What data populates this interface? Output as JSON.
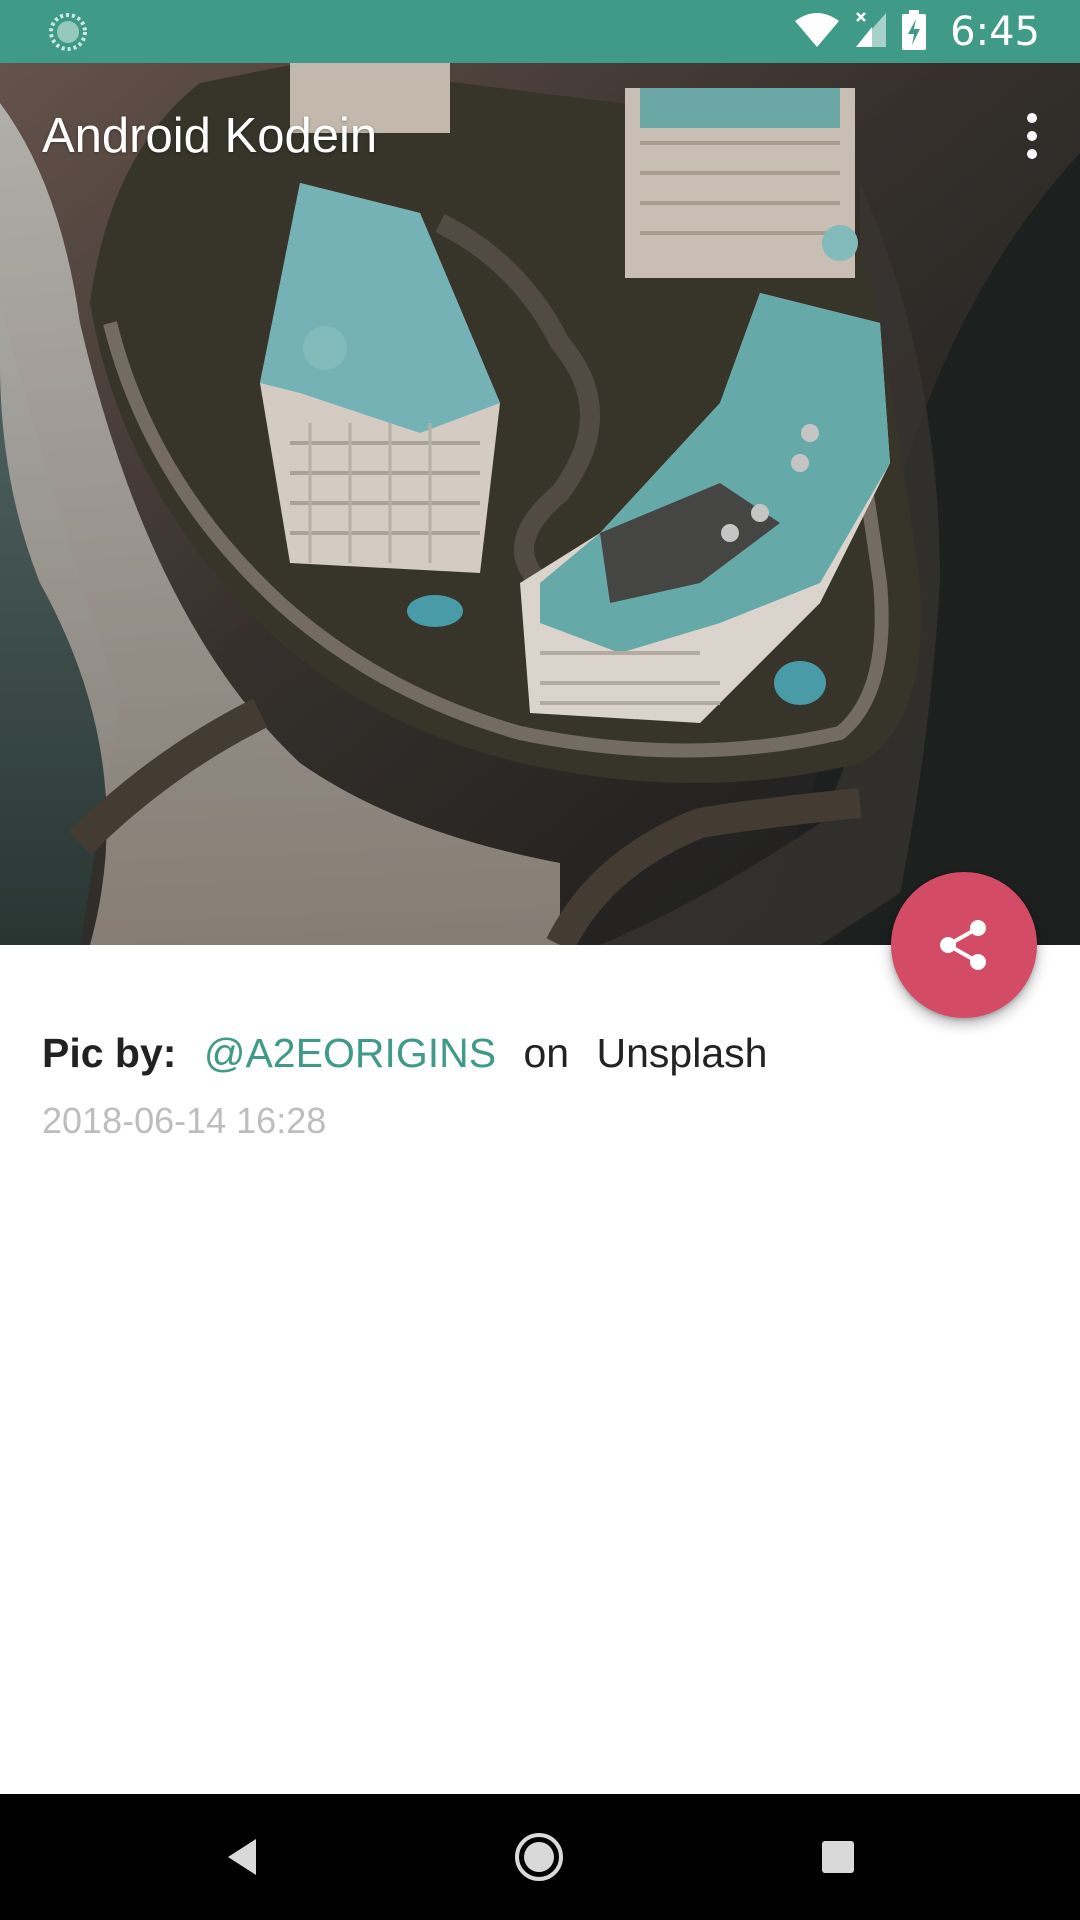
{
  "status_bar": {
    "time": "6:45",
    "icons": [
      "sync-icon",
      "wifi-icon",
      "signal-icon",
      "battery-charging-icon"
    ],
    "background": "#3f9a88"
  },
  "toolbar": {
    "title": "Android Kodein",
    "menu_icon": "overflow-menu-icon"
  },
  "photo": {
    "description_icon": "aerial-photo"
  },
  "fab": {
    "icon": "share-icon",
    "color": "#d44b65"
  },
  "credit": {
    "label": "Pic by:",
    "author": "@A2EORIGINS",
    "connector": "on",
    "site": "Unsplash",
    "timestamp": "2018-06-14 16:28",
    "accent": "#3f9a88"
  },
  "nav_bar": {
    "back": "back-icon",
    "home": "home-icon",
    "recents": "recents-icon"
  }
}
